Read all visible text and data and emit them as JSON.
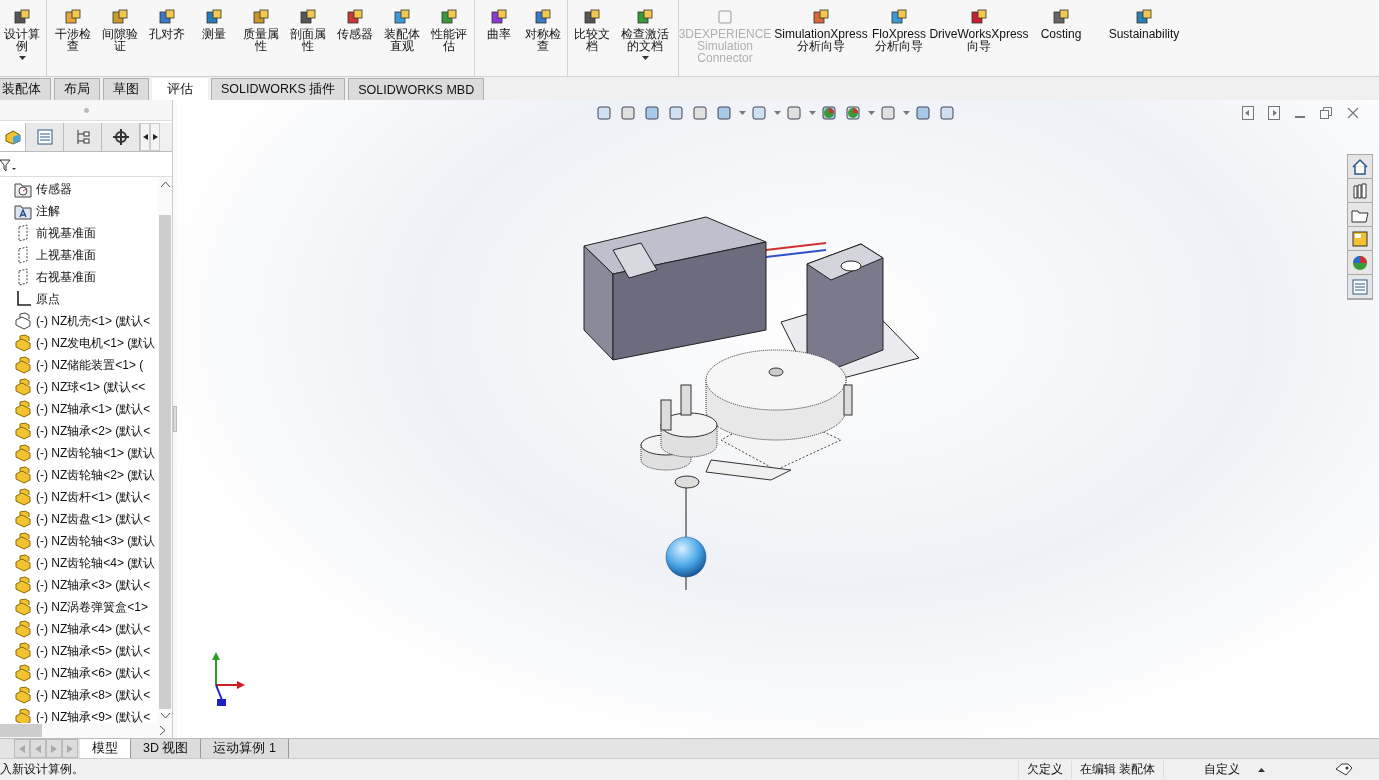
{
  "ribbon": {
    "items": [
      {
        "label": "设计算例",
        "disabled": false,
        "dropdown": true
      },
      {
        "label": "干涉检查",
        "disabled": false,
        "dropdown": false
      },
      {
        "label": "间隙验证",
        "disabled": false,
        "dropdown": false
      },
      {
        "label": "孔对齐",
        "disabled": false,
        "dropdown": false
      },
      {
        "label": "测量",
        "disabled": false,
        "dropdown": false
      },
      {
        "label": "质量属性",
        "disabled": false,
        "dropdown": false
      },
      {
        "label": "剖面属性",
        "disabled": false,
        "dropdown": false
      },
      {
        "label": "传感器",
        "disabled": false,
        "dropdown": false
      },
      {
        "label": "装配体直观",
        "disabled": false,
        "dropdown": false
      },
      {
        "label": "性能评估",
        "disabled": false,
        "dropdown": false
      },
      {
        "label": "曲率",
        "disabled": false,
        "dropdown": false
      },
      {
        "label": "对称检查",
        "disabled": false,
        "dropdown": false
      },
      {
        "label": "比较文档",
        "disabled": false,
        "dropdown": false
      },
      {
        "label": "检查激活的文档",
        "disabled": false,
        "dropdown": true
      },
      {
        "label": "3DEXPERIENCE Simulation Connector",
        "disabled": true,
        "dropdown": false
      },
      {
        "label": "SimulationXpress 分析向导",
        "disabled": false,
        "dropdown": false
      },
      {
        "label": "FloXpress 分析向导",
        "disabled": false,
        "dropdown": false
      },
      {
        "label": "DriveWorksXpress 向导",
        "disabled": false,
        "dropdown": false
      },
      {
        "label": "Costing",
        "disabled": false,
        "dropdown": false
      },
      {
        "label": "Sustainability",
        "disabled": false,
        "dropdown": false
      }
    ]
  },
  "tabs": [
    {
      "label": "装配体",
      "selected": false
    },
    {
      "label": "布局",
      "selected": false
    },
    {
      "label": "草图",
      "selected": false
    },
    {
      "label": "评估",
      "selected": true
    },
    {
      "label": "SOLIDWORKS 插件",
      "selected": false
    },
    {
      "label": "SOLIDWORKS MBD",
      "selected": false
    }
  ],
  "feature_tree": {
    "items": [
      {
        "kind": "sensors",
        "label": "传感器"
      },
      {
        "kind": "annotations",
        "label": "注解"
      },
      {
        "kind": "plane",
        "label": "前视基准面"
      },
      {
        "kind": "plane",
        "label": "上视基准面"
      },
      {
        "kind": "plane",
        "label": "右视基准面"
      },
      {
        "kind": "origin",
        "label": "原点"
      },
      {
        "kind": "part-outline",
        "label": "(-) NZ机壳<1> (默认<"
      },
      {
        "kind": "part",
        "label": "(-) NZ发电机<1> (默认"
      },
      {
        "kind": "part",
        "label": "(-) NZ储能装置<1> ("
      },
      {
        "kind": "part",
        "label": "(-) NZ球<1> (默认<<"
      },
      {
        "kind": "part",
        "label": "(-) NZ轴承<1> (默认<"
      },
      {
        "kind": "part",
        "label": "(-) NZ轴承<2> (默认<"
      },
      {
        "kind": "part",
        "label": "(-) NZ齿轮轴<1> (默认"
      },
      {
        "kind": "part",
        "label": "(-) NZ齿轮轴<2> (默认"
      },
      {
        "kind": "part",
        "label": "(-) NZ齿杆<1> (默认<"
      },
      {
        "kind": "part",
        "label": "(-) NZ齿盘<1> (默认<"
      },
      {
        "kind": "part",
        "label": "(-) NZ齿轮轴<3> (默认"
      },
      {
        "kind": "part",
        "label": "(-) NZ齿轮轴<4> (默认"
      },
      {
        "kind": "part",
        "label": "(-) NZ轴承<3> (默认<"
      },
      {
        "kind": "part",
        "label": "(-) NZ涡卷弹簧盒<1>"
      },
      {
        "kind": "part",
        "label": "(-) NZ轴承<4> (默认<"
      },
      {
        "kind": "part",
        "label": "(-) NZ轴承<5> (默认<"
      },
      {
        "kind": "part",
        "label": "(-) NZ轴承<6> (默认<"
      },
      {
        "kind": "part",
        "label": "(-) NZ轴承<8> (默认<"
      },
      {
        "kind": "part",
        "label": "(-) NZ轴承<9> (默认<"
      }
    ]
  },
  "bottom_tabs": [
    {
      "label": "模型",
      "selected": true
    },
    {
      "label": "3D 视图",
      "selected": false
    },
    {
      "label": "运动算例 1",
      "selected": false
    }
  ],
  "status_bar": {
    "message": "入新设计算例。",
    "fields": [
      "欠定义",
      "在编辑 装配体",
      "自定义"
    ]
  }
}
